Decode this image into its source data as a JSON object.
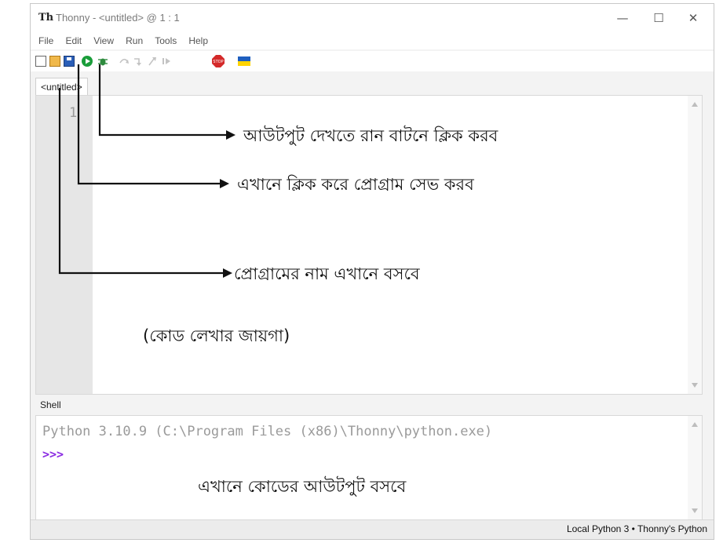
{
  "window": {
    "title": "Thonny  -  <untitled>  @  1 : 1",
    "app_logo_text": "Th",
    "controls": {
      "minimize": "—",
      "maximize": "☐",
      "close": "✕"
    }
  },
  "menu": [
    "File",
    "Edit",
    "View",
    "Run",
    "Tools",
    "Help"
  ],
  "toolbar": {
    "icons": [
      "new-file-icon",
      "open-folder-icon",
      "save-icon",
      "run-icon",
      "debug-icon",
      "step-over-icon",
      "step-into-icon",
      "step-out-icon",
      "resume-icon",
      "stop-icon",
      "flag-icon"
    ],
    "stop_label": "STOP",
    "colors": {
      "run": "#1a9d3a",
      "stop": "#d42a2a",
      "flag_blue": "#1f5fbf",
      "flag_yellow": "#ffd400"
    }
  },
  "editor": {
    "tab_label": "<untitled>",
    "line_number": "1",
    "code_area_label": "(কোড লেখার জায়গা)"
  },
  "annotations": {
    "run": "আউটপুট দেখতে রান বাটনে ক্লিক করব",
    "save": "এখানে ক্লিক করে প্রোগ্রাম সেভ করব",
    "name": "প্রোগ্রামের নাম এখানে বসবে",
    "output": "এখানে কোডের আউটপুট বসবে"
  },
  "shell": {
    "tab_label": "Shell",
    "python_info": "Python 3.10.9 (C:\\Program Files (x86)\\Thonny\\python.exe)",
    "prompt": ">>>"
  },
  "status_bar": {
    "text": "Local Python 3  •  Thonny's Python"
  }
}
